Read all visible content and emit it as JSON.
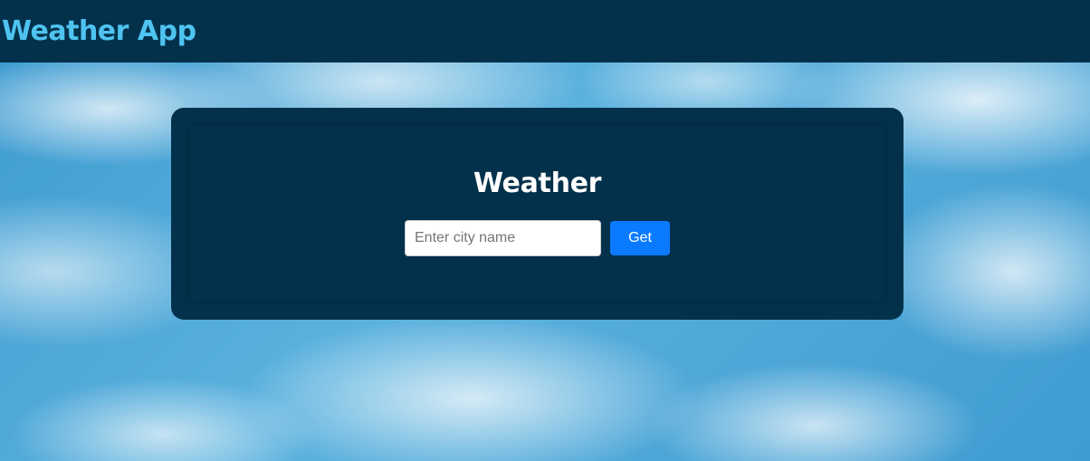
{
  "navbar": {
    "brand": "Weather App",
    "brand_color": "#4fc3f0",
    "background_color": "#03314b"
  },
  "card": {
    "title": "Weather",
    "search": {
      "value": "",
      "placeholder": "Enter city name"
    },
    "get_label": "Get",
    "button_color": "#0a7bff"
  },
  "background": {
    "image": "sky-with-clouds"
  }
}
